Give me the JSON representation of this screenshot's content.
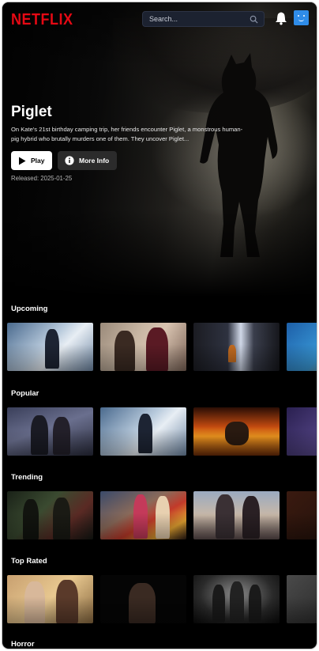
{
  "header": {
    "logo": "NETFLIX",
    "search_placeholder": "Search...",
    "icons": [
      "search-icon",
      "bell-icon",
      "avatar"
    ]
  },
  "hero": {
    "title": "Piglet",
    "description": "On Kate's 21st birthday camping trip, her friends encounter Piglet, a monstrous human-pig hybrid who brutally murders one of them. They uncover Piglet...",
    "play_label": "Play",
    "more_info_label": "More Info",
    "released": "Released: 2025-01-25"
  },
  "rows": [
    {
      "title": "Upcoming"
    },
    {
      "title": "Popular"
    },
    {
      "title": "Trending"
    },
    {
      "title": "Top Rated"
    },
    {
      "title": "Horror"
    }
  ],
  "colors": {
    "brand": "#e50914",
    "background": "#000000",
    "search_bg": "#1c2230",
    "avatar": "#2f8ce8",
    "secondary_button": "#2b2b2b"
  }
}
